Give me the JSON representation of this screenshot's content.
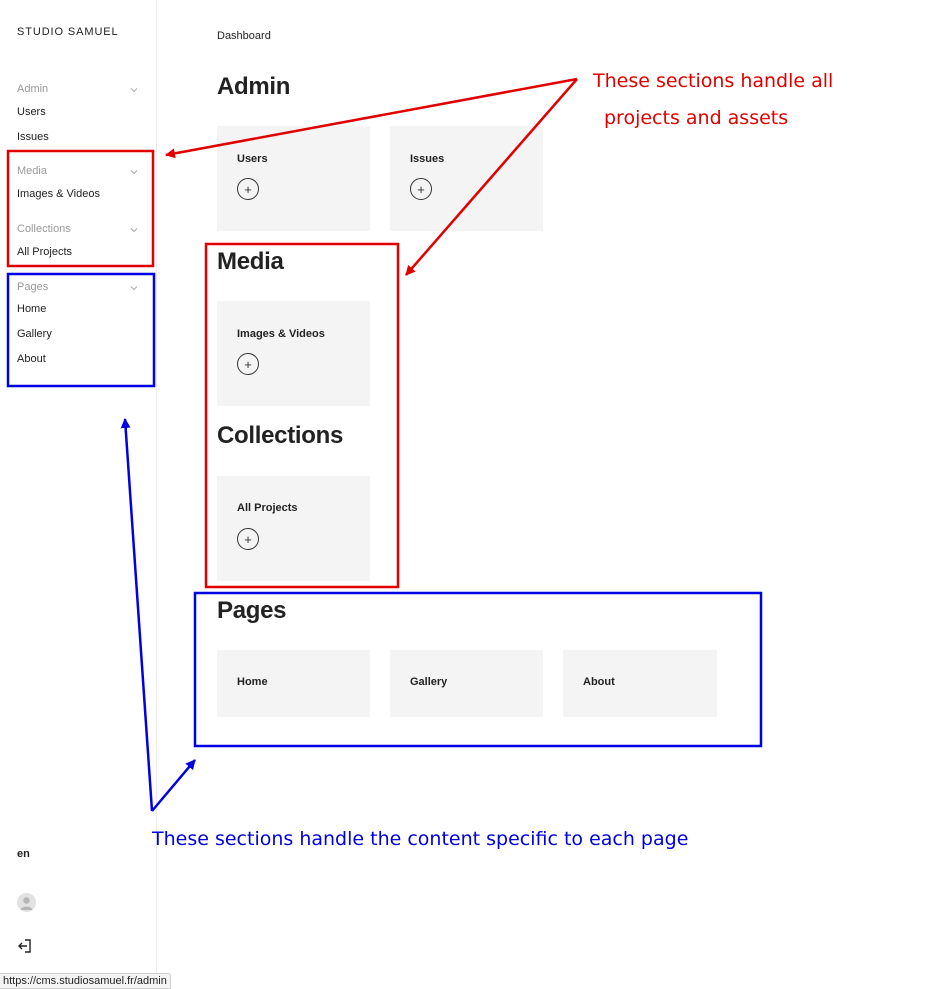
{
  "sidebar": {
    "brand": "STUDIO SAMUEL",
    "groups": [
      {
        "title": "Admin",
        "items": [
          "Users",
          "Issues"
        ]
      },
      {
        "title": "Media",
        "items": [
          "Images & Videos"
        ]
      },
      {
        "title": "Collections",
        "items": [
          "All Projects"
        ]
      },
      {
        "title": "Pages",
        "items": [
          "Home",
          "Gallery",
          "About"
        ]
      }
    ],
    "language": "en",
    "status_url": "https://cms.studiosamuel.fr/admin"
  },
  "main": {
    "breadcrumb": "Dashboard",
    "sections": [
      {
        "title": "Admin",
        "cards": [
          "Users",
          "Issues"
        ]
      },
      {
        "title": "Media",
        "cards": [
          "Images & Videos"
        ]
      },
      {
        "title": "Collections",
        "cards": [
          "All Projects"
        ]
      },
      {
        "title": "Pages",
        "cards": [
          "Home",
          "Gallery",
          "About"
        ]
      }
    ],
    "add_symbol": "+"
  },
  "annotations": {
    "red_line1": "These sections handle all",
    "red_line2": "projects and assets",
    "blue_text": "These sections handle the content specific to each page"
  },
  "colors": {
    "annotation_red": "#e00000",
    "annotation_blue": "#0000e0",
    "card_bg": "#f4f4f4"
  }
}
